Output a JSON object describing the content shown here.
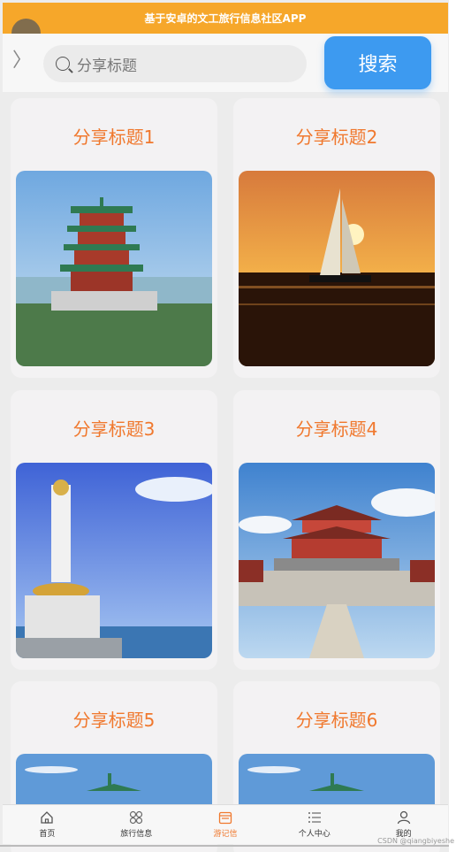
{
  "app": {
    "title": "基于安卓的文工旅行信息社区APP"
  },
  "search": {
    "placeholder": "分享标题",
    "button_label": "搜索"
  },
  "cards": [
    {
      "title": "分享标题1",
      "image": "pagoda"
    },
    {
      "title": "分享标题2",
      "image": "sailboat-sunset"
    },
    {
      "title": "分享标题3",
      "image": "guanyin-statue"
    },
    {
      "title": "分享标题4",
      "image": "temple-palace"
    },
    {
      "title": "分享标题5",
      "image": "pagoda"
    },
    {
      "title": "分享标题6",
      "image": "pagoda"
    }
  ],
  "tabbar": {
    "items": [
      {
        "label": "首页",
        "icon": "home-icon"
      },
      {
        "label": "旅行信息",
        "icon": "grid-icon"
      },
      {
        "label": "游记信",
        "icon": "calendar-icon"
      },
      {
        "label": "个人中心",
        "icon": "list-icon"
      },
      {
        "label": "我的",
        "icon": "user-icon"
      }
    ],
    "active_index": 2
  },
  "watermark": "CSDN @qiangbiyeshe"
}
